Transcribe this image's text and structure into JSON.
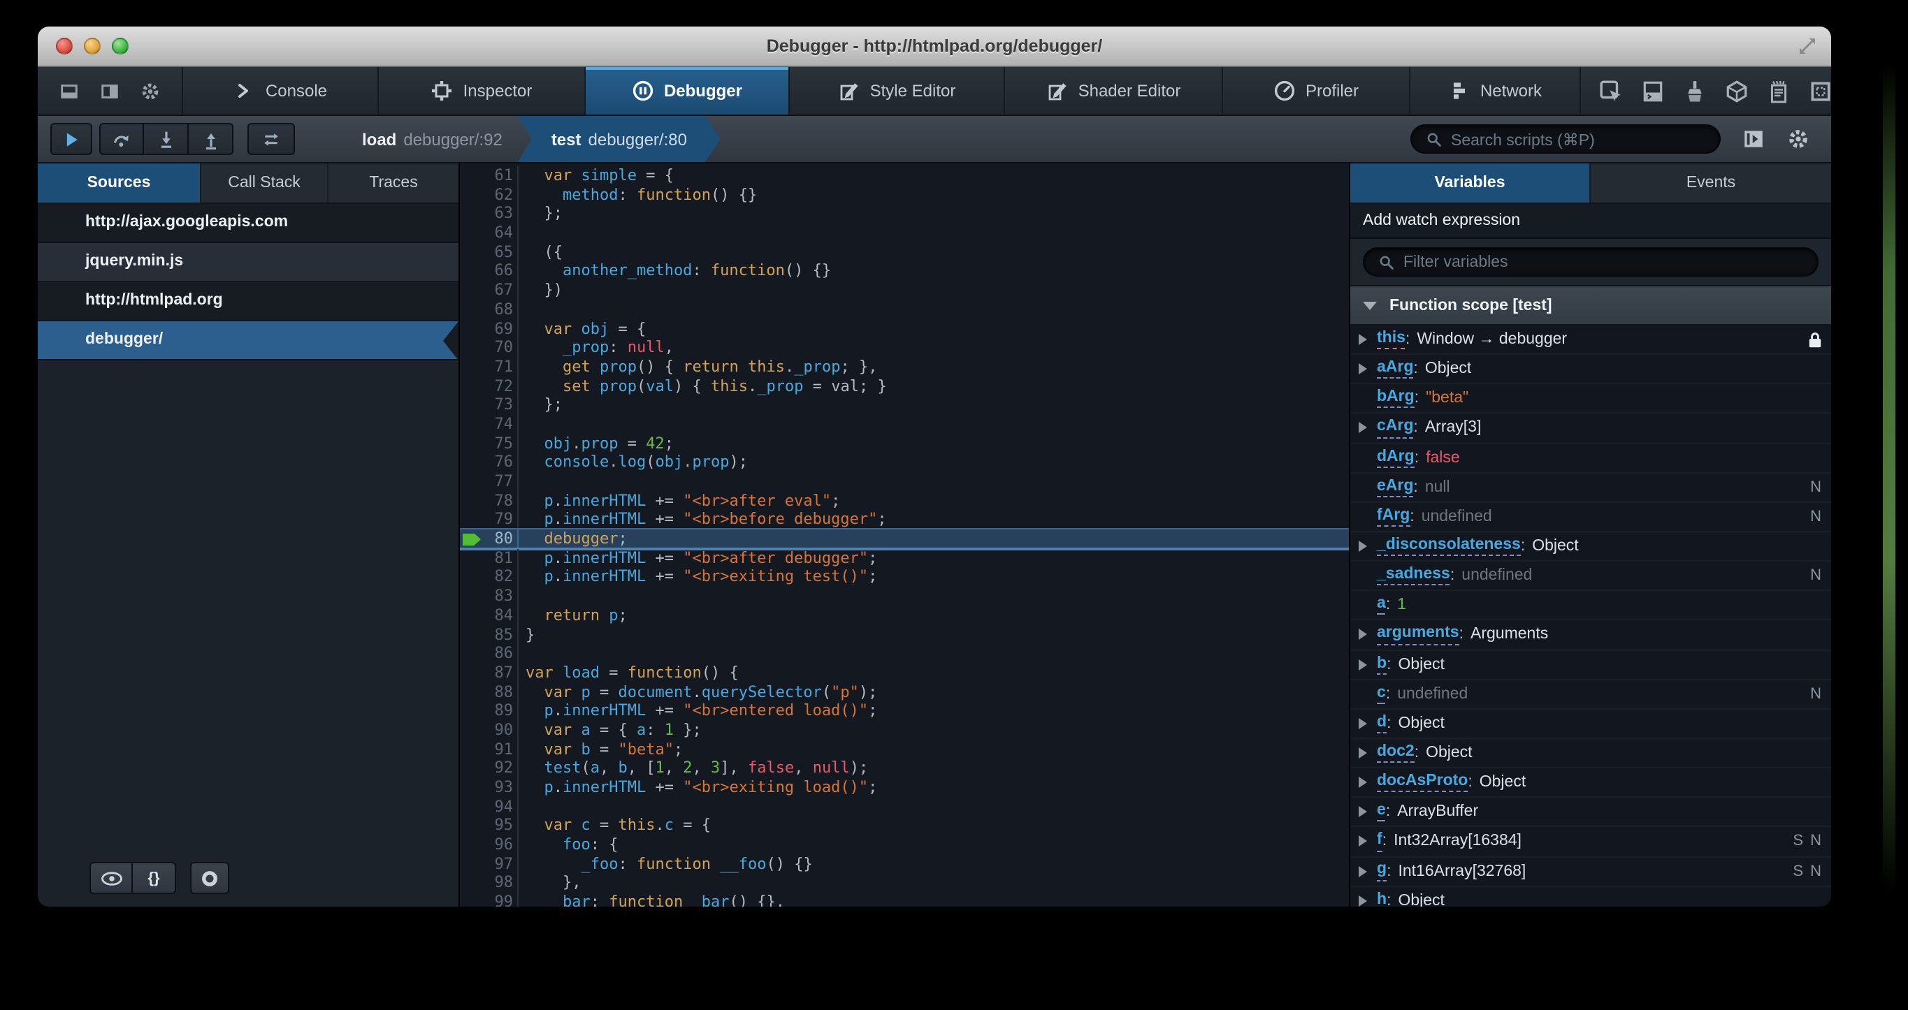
{
  "window": {
    "title": "Debugger - http://htmlpad.org/debugger/"
  },
  "toolbar": {
    "quick_icons": [
      "dock-bottom-icon",
      "dock-side-icon",
      "gear-icon"
    ],
    "tabs": [
      {
        "label": "Console",
        "icon": "console-icon",
        "active": false
      },
      {
        "label": "Inspector",
        "icon": "inspector-icon",
        "active": false
      },
      {
        "label": "Debugger",
        "icon": "debugger-icon",
        "active": true
      },
      {
        "label": "Style Editor",
        "icon": "style-editor-icon",
        "active": false
      },
      {
        "label": "Shader Editor",
        "icon": "shader-editor-icon",
        "active": false
      },
      {
        "label": "Profiler",
        "icon": "profiler-icon",
        "active": false
      },
      {
        "label": "Network",
        "icon": "network-icon",
        "active": false
      }
    ],
    "right_icons": [
      "pick-element-icon",
      "split-console-icon",
      "paintbrush-icon",
      "tilt-3d-icon",
      "scratchpad-icon",
      "responsive-mode-icon"
    ]
  },
  "debugger_toolbar": {
    "breadcrumbs": [
      {
        "fn": "load",
        "loc": "debugger/:92",
        "active": false
      },
      {
        "fn": "test",
        "loc": "debugger/:80",
        "active": true
      }
    ],
    "search_placeholder": "Search scripts (⌘P)"
  },
  "sources_panel": {
    "tabs": [
      {
        "label": "Sources",
        "active": true
      },
      {
        "label": "Call Stack",
        "active": false
      },
      {
        "label": "Traces",
        "active": false
      }
    ],
    "items": [
      {
        "label": "http://ajax.googleapis.com",
        "kind": "group",
        "selected": false
      },
      {
        "label": "jquery.min.js",
        "kind": "file",
        "selected": false
      },
      {
        "label": "http://htmlpad.org",
        "kind": "group",
        "selected": false
      },
      {
        "label": "debugger/",
        "kind": "file",
        "selected": true
      }
    ],
    "prettyprint_label": "{}"
  },
  "editor": {
    "first_line": 61,
    "current_line": 80,
    "lines": [
      [
        [
          "p",
          "  "
        ],
        [
          "k",
          "var"
        ],
        [
          "p",
          " "
        ],
        [
          "v",
          "simple"
        ],
        [
          "p",
          " = {"
        ]
      ],
      [
        [
          "p",
          "    "
        ],
        [
          "v",
          "method"
        ],
        [
          "p",
          ": "
        ],
        [
          "k",
          "function"
        ],
        [
          "p",
          "() {}"
        ]
      ],
      [
        [
          "p",
          "  };"
        ]
      ],
      [],
      [
        [
          "p",
          "  ({"
        ]
      ],
      [
        [
          "p",
          "    "
        ],
        [
          "v",
          "another_method"
        ],
        [
          "p",
          ": "
        ],
        [
          "k",
          "function"
        ],
        [
          "p",
          "() {}"
        ]
      ],
      [
        [
          "p",
          "  })"
        ]
      ],
      [],
      [
        [
          "p",
          "  "
        ],
        [
          "k",
          "var"
        ],
        [
          "p",
          " "
        ],
        [
          "v",
          "obj"
        ],
        [
          "p",
          " = {"
        ]
      ],
      [
        [
          "p",
          "    "
        ],
        [
          "v",
          "_prop"
        ],
        [
          "p",
          ": "
        ],
        [
          "x",
          "null"
        ],
        [
          "p",
          ","
        ]
      ],
      [
        [
          "p",
          "    "
        ],
        [
          "k",
          "get"
        ],
        [
          "p",
          " "
        ],
        [
          "v",
          "prop"
        ],
        [
          "p",
          "() { "
        ],
        [
          "k",
          "return"
        ],
        [
          "p",
          " "
        ],
        [
          "k",
          "this"
        ],
        [
          "p",
          "."
        ],
        [
          "v",
          "_prop"
        ],
        [
          "p",
          "; },"
        ]
      ],
      [
        [
          "p",
          "    "
        ],
        [
          "k",
          "set"
        ],
        [
          "p",
          " "
        ],
        [
          "v",
          "prop"
        ],
        [
          "p",
          "("
        ],
        [
          "v",
          "val"
        ],
        [
          "p",
          ") { "
        ],
        [
          "k",
          "this"
        ],
        [
          "p",
          "."
        ],
        [
          "v",
          "_prop"
        ],
        [
          "p",
          " = val; }"
        ]
      ],
      [
        [
          "p",
          "  };"
        ]
      ],
      [],
      [
        [
          "p",
          "  "
        ],
        [
          "v",
          "obj"
        ],
        [
          "p",
          "."
        ],
        [
          "v",
          "prop"
        ],
        [
          "p",
          " = "
        ],
        [
          "n",
          "42"
        ],
        [
          "p",
          ";"
        ]
      ],
      [
        [
          "p",
          "  "
        ],
        [
          "v",
          "console"
        ],
        [
          "p",
          "."
        ],
        [
          "v",
          "log"
        ],
        [
          "p",
          "("
        ],
        [
          "v",
          "obj"
        ],
        [
          "p",
          "."
        ],
        [
          "v",
          "prop"
        ],
        [
          "p",
          ");"
        ]
      ],
      [],
      [
        [
          "p",
          "  "
        ],
        [
          "v",
          "p"
        ],
        [
          "p",
          "."
        ],
        [
          "v",
          "innerHTML"
        ],
        [
          "p",
          " += "
        ],
        [
          "s",
          "\"<br>after eval\""
        ],
        [
          "p",
          ";"
        ]
      ],
      [
        [
          "p",
          "  "
        ],
        [
          "v",
          "p"
        ],
        [
          "p",
          "."
        ],
        [
          "v",
          "innerHTML"
        ],
        [
          "p",
          " += "
        ],
        [
          "s",
          "\"<br>before debugger\""
        ],
        [
          "p",
          ";"
        ]
      ],
      [
        [
          "p",
          "  "
        ],
        [
          "k",
          "debugger"
        ],
        [
          "p",
          ";"
        ]
      ],
      [
        [
          "p",
          "  "
        ],
        [
          "v",
          "p"
        ],
        [
          "p",
          "."
        ],
        [
          "v",
          "innerHTML"
        ],
        [
          "p",
          " += "
        ],
        [
          "s",
          "\"<br>after debugger\""
        ],
        [
          "p",
          ";"
        ]
      ],
      [
        [
          "p",
          "  "
        ],
        [
          "v",
          "p"
        ],
        [
          "p",
          "."
        ],
        [
          "v",
          "innerHTML"
        ],
        [
          "p",
          " += "
        ],
        [
          "s",
          "\"<br>exiting test()\""
        ],
        [
          "p",
          ";"
        ]
      ],
      [],
      [
        [
          "p",
          "  "
        ],
        [
          "k",
          "return"
        ],
        [
          "p",
          " "
        ],
        [
          "v",
          "p"
        ],
        [
          "p",
          ";"
        ]
      ],
      [
        [
          "p",
          "}"
        ]
      ],
      [],
      [
        [
          "k",
          "var"
        ],
        [
          "p",
          " "
        ],
        [
          "v",
          "load"
        ],
        [
          "p",
          " = "
        ],
        [
          "k",
          "function"
        ],
        [
          "p",
          "() {"
        ]
      ],
      [
        [
          "p",
          "  "
        ],
        [
          "k",
          "var"
        ],
        [
          "p",
          " "
        ],
        [
          "v",
          "p"
        ],
        [
          "p",
          " = "
        ],
        [
          "v",
          "document"
        ],
        [
          "p",
          "."
        ],
        [
          "v",
          "querySelector"
        ],
        [
          "p",
          "("
        ],
        [
          "s",
          "\"p\""
        ],
        [
          "p",
          ");"
        ]
      ],
      [
        [
          "p",
          "  "
        ],
        [
          "v",
          "p"
        ],
        [
          "p",
          "."
        ],
        [
          "v",
          "innerHTML"
        ],
        [
          "p",
          " += "
        ],
        [
          "s",
          "\"<br>entered load()\""
        ],
        [
          "p",
          ";"
        ]
      ],
      [
        [
          "p",
          "  "
        ],
        [
          "k",
          "var"
        ],
        [
          "p",
          " "
        ],
        [
          "v",
          "a"
        ],
        [
          "p",
          " = { "
        ],
        [
          "v",
          "a"
        ],
        [
          "p",
          ": "
        ],
        [
          "n",
          "1"
        ],
        [
          "p",
          " };"
        ]
      ],
      [
        [
          "p",
          "  "
        ],
        [
          "k",
          "var"
        ],
        [
          "p",
          " "
        ],
        [
          "v",
          "b"
        ],
        [
          "p",
          " = "
        ],
        [
          "s",
          "\"beta\""
        ],
        [
          "p",
          ";"
        ]
      ],
      [
        [
          "p",
          "  "
        ],
        [
          "v",
          "test"
        ],
        [
          "p",
          "("
        ],
        [
          "v",
          "a"
        ],
        [
          "p",
          ", "
        ],
        [
          "v",
          "b"
        ],
        [
          "p",
          ", ["
        ],
        [
          "n",
          "1"
        ],
        [
          "p",
          ", "
        ],
        [
          "n",
          "2"
        ],
        [
          "p",
          ", "
        ],
        [
          "n",
          "3"
        ],
        [
          "p",
          "], "
        ],
        [
          "x",
          "false"
        ],
        [
          "p",
          ", "
        ],
        [
          "x",
          "null"
        ],
        [
          "p",
          ");"
        ]
      ],
      [
        [
          "p",
          "  "
        ],
        [
          "v",
          "p"
        ],
        [
          "p",
          "."
        ],
        [
          "v",
          "innerHTML"
        ],
        [
          "p",
          " += "
        ],
        [
          "s",
          "\"<br>exiting load()\""
        ],
        [
          "p",
          ";"
        ]
      ],
      [],
      [
        [
          "p",
          "  "
        ],
        [
          "k",
          "var"
        ],
        [
          "p",
          " "
        ],
        [
          "v",
          "c"
        ],
        [
          "p",
          " = "
        ],
        [
          "k",
          "this"
        ],
        [
          "p",
          "."
        ],
        [
          "v",
          "c"
        ],
        [
          "p",
          " = {"
        ]
      ],
      [
        [
          "p",
          "    "
        ],
        [
          "v",
          "foo"
        ],
        [
          "p",
          ": {"
        ]
      ],
      [
        [
          "p",
          "      "
        ],
        [
          "v",
          "_foo"
        ],
        [
          "p",
          ": "
        ],
        [
          "k",
          "function"
        ],
        [
          "p",
          " "
        ],
        [
          "v",
          "__foo"
        ],
        [
          "p",
          "() {}"
        ]
      ],
      [
        [
          "p",
          "    },"
        ]
      ],
      [
        [
          "p",
          "    "
        ],
        [
          "v",
          "bar"
        ],
        [
          "p",
          ": "
        ],
        [
          "k",
          "function"
        ],
        [
          "p",
          " "
        ],
        [
          "v",
          "_bar"
        ],
        [
          "p",
          "() {},"
        ]
      ]
    ]
  },
  "variables_panel": {
    "tabs": [
      {
        "label": "Variables",
        "active": true
      },
      {
        "label": "Events",
        "active": false
      }
    ],
    "watch_label": "Add watch expression",
    "filter_placeholder": "Filter variables",
    "scope_label": "Function scope [test]",
    "rows": [
      {
        "name": "this",
        "value": "Window → debugger",
        "vtype": "plain",
        "expandable": true,
        "lock": true,
        "underline": "pink"
      },
      {
        "name": "aArg",
        "value": "Object",
        "vtype": "plain",
        "expandable": true
      },
      {
        "name": "bArg",
        "value": "\"beta\"",
        "vtype": "string",
        "expandable": false
      },
      {
        "name": "cArg",
        "value": "Array[3]",
        "vtype": "plain",
        "expandable": true
      },
      {
        "name": "dArg",
        "value": "false",
        "vtype": "bool",
        "expandable": false
      },
      {
        "name": "eArg",
        "value": "null",
        "vtype": "dim",
        "expandable": false,
        "badge": "N"
      },
      {
        "name": "fArg",
        "value": "undefined",
        "vtype": "dim",
        "expandable": false,
        "badge": "N"
      },
      {
        "name": "_disconsolateness",
        "value": "Object",
        "vtype": "plain",
        "expandable": true
      },
      {
        "name": "_sadness",
        "value": "undefined",
        "vtype": "dim",
        "expandable": false,
        "badge": "N"
      },
      {
        "name": "a",
        "value": "1",
        "vtype": "number",
        "expandable": false
      },
      {
        "name": "arguments",
        "value": "Arguments",
        "vtype": "plain",
        "expandable": true
      },
      {
        "name": "b",
        "value": "Object",
        "vtype": "plain",
        "expandable": true
      },
      {
        "name": "c",
        "value": "undefined",
        "vtype": "dim",
        "expandable": false,
        "badge": "N"
      },
      {
        "name": "d",
        "value": "Object",
        "vtype": "plain",
        "expandable": true
      },
      {
        "name": "doc2",
        "value": "Object",
        "vtype": "plain",
        "expandable": true
      },
      {
        "name": "docAsProto",
        "value": "Object",
        "vtype": "plain",
        "expandable": true
      },
      {
        "name": "e",
        "value": "ArrayBuffer",
        "vtype": "plain",
        "expandable": true
      },
      {
        "name": "f",
        "value": "Int32Array[16384]",
        "vtype": "plain",
        "expandable": true,
        "badge": "S N"
      },
      {
        "name": "g",
        "value": "Int16Array[32768]",
        "vtype": "plain",
        "expandable": true,
        "badge": "S N"
      },
      {
        "name": "h",
        "value": "Object",
        "vtype": "plain",
        "expandable": true
      }
    ]
  },
  "colors": {
    "accent_blue": "#1d4e78",
    "selection_blue": "#2c5f8d",
    "tab_highlight": "#54aee6",
    "keyword": "#d2a351",
    "identifier": "#46a9e0",
    "string": "#d97433",
    "number": "#68b948",
    "atom_red": "#ec5866",
    "exec_arrow_green": "#53bd35",
    "current_line_bg": "#27415d"
  }
}
